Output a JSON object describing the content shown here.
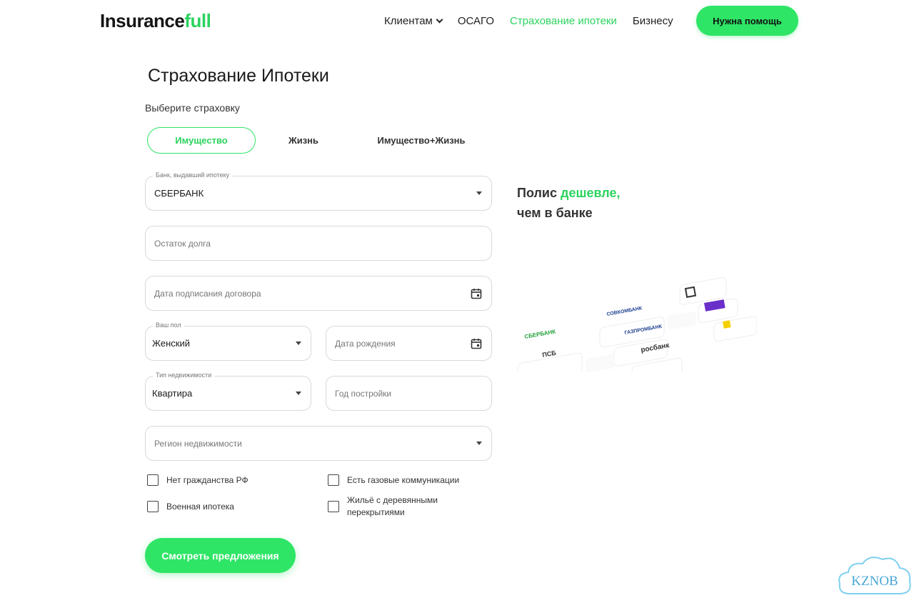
{
  "header": {
    "logo_main": "Insurance",
    "logo_accent": "full",
    "nav": [
      {
        "label": "Клиентам"
      },
      {
        "label": "ОСАГО"
      },
      {
        "label": "Страхование ипотеки"
      },
      {
        "label": "Бизнесу"
      }
    ],
    "help_button": "Нужна помощь"
  },
  "main": {
    "title": "Страхование Ипотеки",
    "subtitle": "Выберите страховку",
    "tabs": [
      {
        "label": "Имущество"
      },
      {
        "label": "Жизнь"
      },
      {
        "label": "Имущество+Жизнь"
      }
    ],
    "form": {
      "bank": {
        "label": "Банк, выдавший ипотеку",
        "value": "СБЕРБАНК"
      },
      "debt": {
        "placeholder": "Остаток долга"
      },
      "contract_date": {
        "placeholder": "Дата подписания договора"
      },
      "gender": {
        "label": "Ваш пол",
        "value": "Женский"
      },
      "birth_date": {
        "placeholder": "Дата рождения"
      },
      "property_type": {
        "label": "Тип недвижимости",
        "value": "Квартира"
      },
      "build_year": {
        "placeholder": "Год постройки"
      },
      "region": {
        "placeholder": "Регион недвижимости"
      },
      "checkboxes": [
        {
          "label": "Нет гражданства РФ"
        },
        {
          "label": "Есть газовые коммуникации"
        },
        {
          "label": "Военная ипотека"
        },
        {
          "label": "Жильё с деревянными перекрытиями"
        }
      ],
      "submit": "Смотреть предложения"
    },
    "promo": {
      "line1_prefix": "Полис",
      "line1_accent": "дешевле,",
      "line2": "чем в банке"
    },
    "bank_logos": [
      "СБЕРБАНК",
      "ПСБ",
      "СОВКОМБАНК",
      "ГАЗПРОМБАНК",
      "росбанк"
    ],
    "watermark": "KZNOB"
  },
  "colors": {
    "accent": "#2ee566",
    "accent_text": "#2bd35f"
  }
}
